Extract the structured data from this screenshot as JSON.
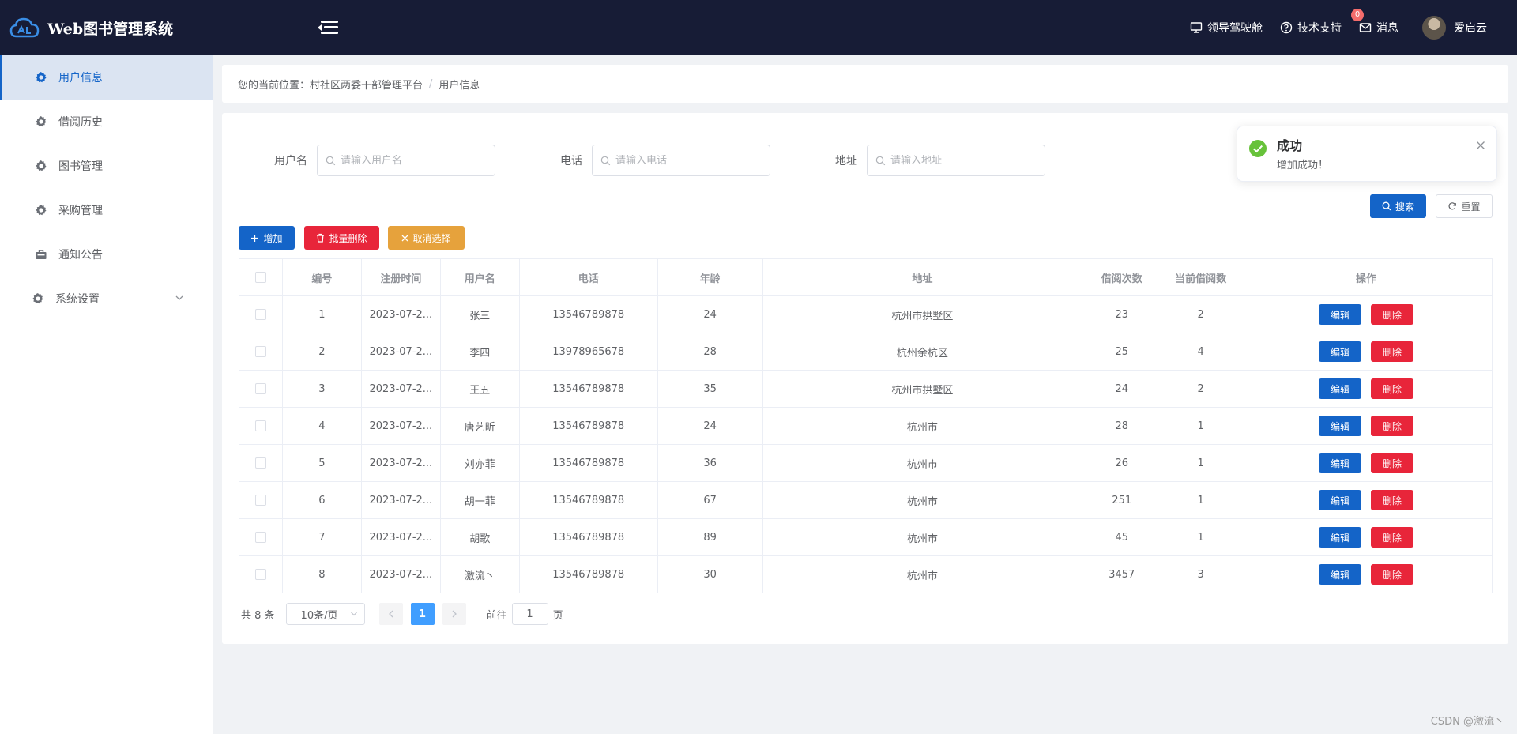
{
  "app": {
    "title": "Web图书管理系统"
  },
  "header": {
    "items": [
      {
        "label": "领导驾驶舱"
      },
      {
        "label": "技术支持"
      },
      {
        "label": "消息",
        "badge": "0"
      }
    ],
    "user_name": "爱启云"
  },
  "sidebar": {
    "items": [
      {
        "label": "用户信息",
        "active": true
      },
      {
        "label": "借阅历史"
      },
      {
        "label": "图书管理"
      },
      {
        "label": "采购管理"
      },
      {
        "label": "通知公告"
      },
      {
        "label": "系统设置"
      }
    ]
  },
  "breadcrumb": {
    "prefix": "您的当前位置：",
    "parent": "村社区两委干部管理平台",
    "separator": "/",
    "current": "用户信息"
  },
  "search": {
    "username_label": "用户名",
    "username_placeholder": "请输入用户名",
    "phone_label": "电话",
    "phone_placeholder": "请输入电话",
    "address_label": "地址",
    "address_placeholder": "请输入地址",
    "search_label": "搜索",
    "reset_label": "重置"
  },
  "toolbar": {
    "add_label": "增加",
    "batch_delete_label": "批量删除",
    "cancel_select_label": "取消选择"
  },
  "table": {
    "headers": [
      "编号",
      "注册时间",
      "用户名",
      "电话",
      "年龄",
      "地址",
      "借阅次数",
      "当前借阅数",
      "操作"
    ],
    "edit_label": "编辑",
    "delete_label": "删除",
    "rows": [
      [
        "1",
        "2023-07-2...",
        "张三",
        "13546789878",
        "24",
        "杭州市拱墅区",
        "23",
        "2"
      ],
      [
        "2",
        "2023-07-2...",
        "李四",
        "13978965678",
        "28",
        "杭州余杭区",
        "25",
        "4"
      ],
      [
        "3",
        "2023-07-2...",
        "王五",
        "13546789878",
        "35",
        "杭州市拱墅区",
        "24",
        "2"
      ],
      [
        "4",
        "2023-07-2...",
        "唐艺昕",
        "13546789878",
        "24",
        "杭州市",
        "28",
        "1"
      ],
      [
        "5",
        "2023-07-2...",
        "刘亦菲",
        "13546789878",
        "36",
        "杭州市",
        "26",
        "1"
      ],
      [
        "6",
        "2023-07-2...",
        "胡一菲",
        "13546789878",
        "67",
        "杭州市",
        "251",
        "1"
      ],
      [
        "7",
        "2023-07-2...",
        "胡歌",
        "13546789878",
        "89",
        "杭州市",
        "45",
        "1"
      ],
      [
        "8",
        "2023-07-2...",
        "激流丶",
        "13546789878",
        "30",
        "杭州市",
        "3457",
        "3"
      ]
    ]
  },
  "pagination": {
    "total": "共 8 条",
    "page_size": "10条/页",
    "current_page": "1",
    "goto_label": "前往",
    "goto_value": "1",
    "page_suffix": "页"
  },
  "notification": {
    "title": "成功",
    "message": "增加成功！"
  },
  "watermark": "CSDN @激流丶",
  "colors": {
    "header_bg": "#171c36",
    "primary": "#1464c8",
    "danger": "#e8253a",
    "warning": "#e6a23c",
    "success": "#67c23a"
  }
}
